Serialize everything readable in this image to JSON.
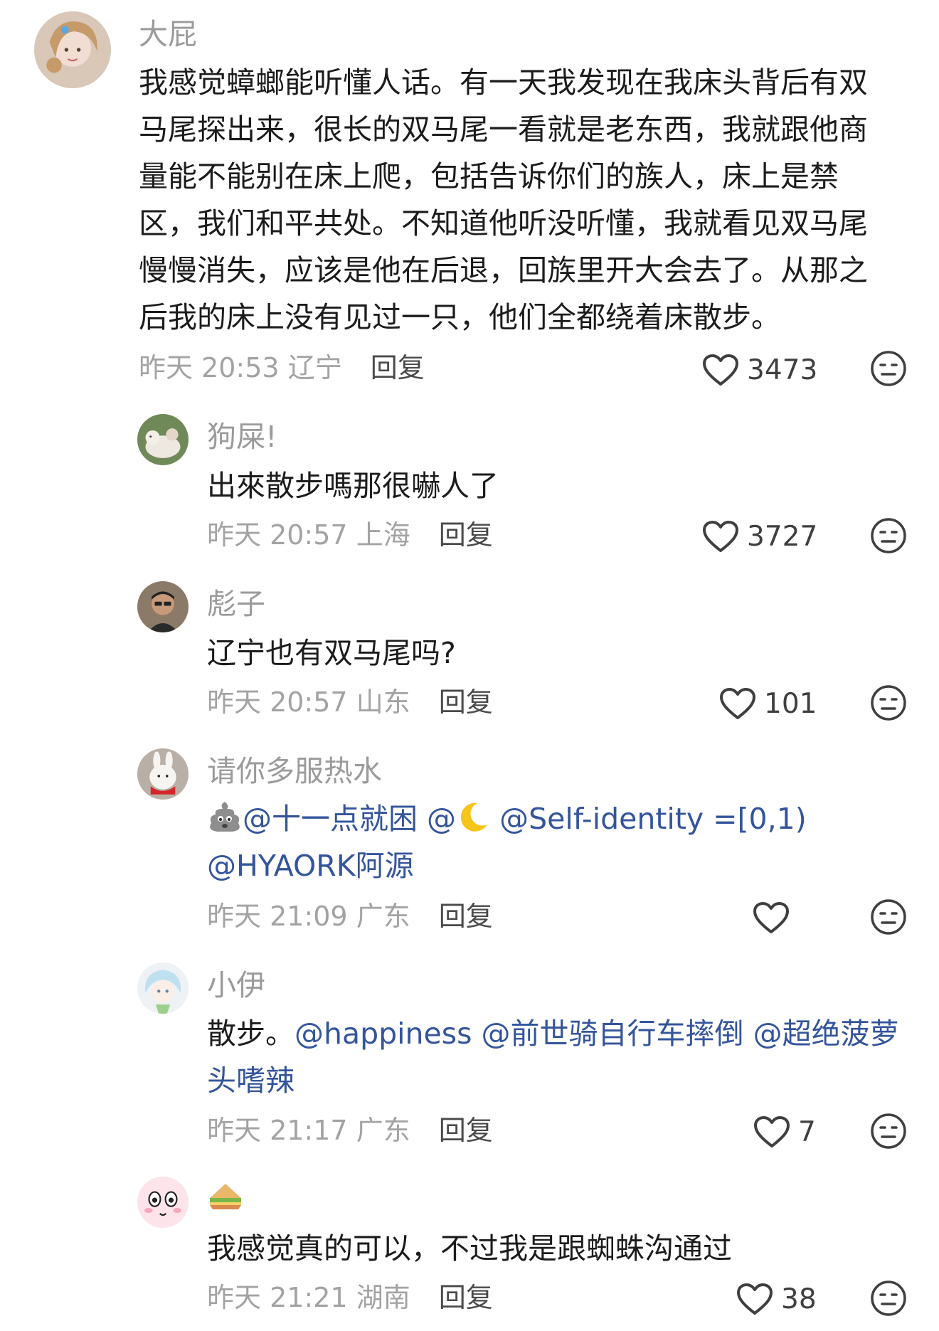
{
  "comments": [
    {
      "username": "大屁",
      "lines": [
        "我感觉蟑螂能听懂人话。有一天我发现在我床头背后有双",
        "马尾探出来，很长的双马尾一看就是老东西，我就跟他商",
        "量能不能别在床上爬，包括告诉你们的族人，床上是禁",
        "区，我们和平共处。不知道他听没听懂，我就看见双马尾",
        "慢慢消失，应该是他在后退，回族里开大会去了。从那之",
        "后我的床上没有见过一只，他们全都绕着床散步。"
      ],
      "time": "昨天 20:53",
      "location": "辽宁",
      "reply_label": "回复",
      "likes": "3473"
    },
    {
      "username": "狗屎!",
      "text": "出來散步嗎那很嚇人了",
      "time": "昨天 20:57",
      "location": "上海",
      "reply_label": "回复",
      "likes": "3727"
    },
    {
      "username": "彪子",
      "text": "辽宁也有双马尾吗?",
      "time": "昨天 20:57",
      "location": "山东",
      "reply_label": "回复",
      "likes": "101"
    },
    {
      "username": "请你多服热水",
      "mention_1": "@十一点就困",
      "mention_2": "@",
      "mention_3": "@Self-identity =[0,1)",
      "mention_4": "@HYAORK阿源",
      "time": "昨天 21:09",
      "location": "广东",
      "reply_label": "回复",
      "likes": ""
    },
    {
      "username": "小伊",
      "prefix": "散步。",
      "mention_1": "@happiness",
      "mention_2": "@前世骑自行车摔倒",
      "mention_3": "@超绝菠萝",
      "mention_4": "头嗜辣",
      "time": "昨天 21:17",
      "location": "广东",
      "reply_label": "回复",
      "likes": "7"
    },
    {
      "username": "",
      "text": "我感觉真的可以，不过我是跟蜘蛛沟通过",
      "time": "昨天 21:21",
      "location": "湖南",
      "reply_label": "回复",
      "likes": "38"
    }
  ],
  "icons": {
    "like": "heart-outline-icon",
    "dislike": "unamused-face-icon",
    "sandwich": "sandwich-emoji",
    "moon": "crescent-moon-emoji",
    "poop": "gray-poop-emoji"
  },
  "colors": {
    "mention": "#34559c",
    "meta": "#a3a3a3",
    "username": "#9b9b9b"
  }
}
